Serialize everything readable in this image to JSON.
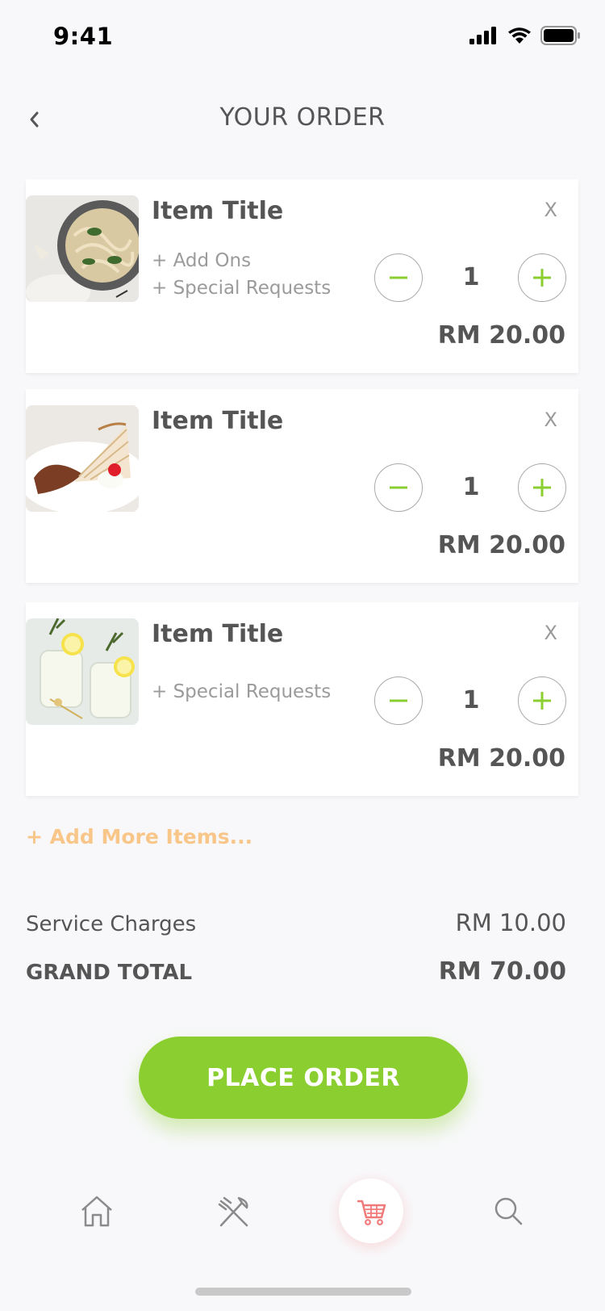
{
  "status_bar": {
    "time": "9:41"
  },
  "header": {
    "title": "YOUR ORDER"
  },
  "order": {
    "items": [
      {
        "title": "Item Title",
        "options": [
          "+ Add Ons",
          "+ Special Requests"
        ],
        "quantity": "1",
        "price": "RM 20.00",
        "remove_label": "X",
        "image": "pasta-photo"
      },
      {
        "title": "Item Title",
        "options": [],
        "quantity": "1",
        "price": "RM 20.00",
        "remove_label": "X",
        "image": "cake-photo"
      },
      {
        "title": "Item Title",
        "options": [
          "+ Special Requests"
        ],
        "quantity": "1",
        "price": "RM 20.00",
        "remove_label": "X",
        "image": "lemonade-photo"
      }
    ],
    "add_more_label": "+ Add More Items..."
  },
  "summary": {
    "service_label": "Service Charges",
    "service_value": "RM 10.00",
    "total_label": "GRAND TOTAL",
    "total_value": "RM 70.00"
  },
  "cta": {
    "place_order_label": "PLACE ORDER"
  },
  "tab_bar": {
    "items": [
      {
        "icon": "home-icon",
        "active": false
      },
      {
        "icon": "fork-knife-icon",
        "active": false
      },
      {
        "icon": "cart-icon",
        "active": true
      },
      {
        "icon": "search-icon",
        "active": false
      }
    ]
  },
  "colors": {
    "accent_green": "#8bce30",
    "accent_orange": "#f9c68a",
    "cart_red": "#f07a7a",
    "background": "#f8f8fa"
  }
}
